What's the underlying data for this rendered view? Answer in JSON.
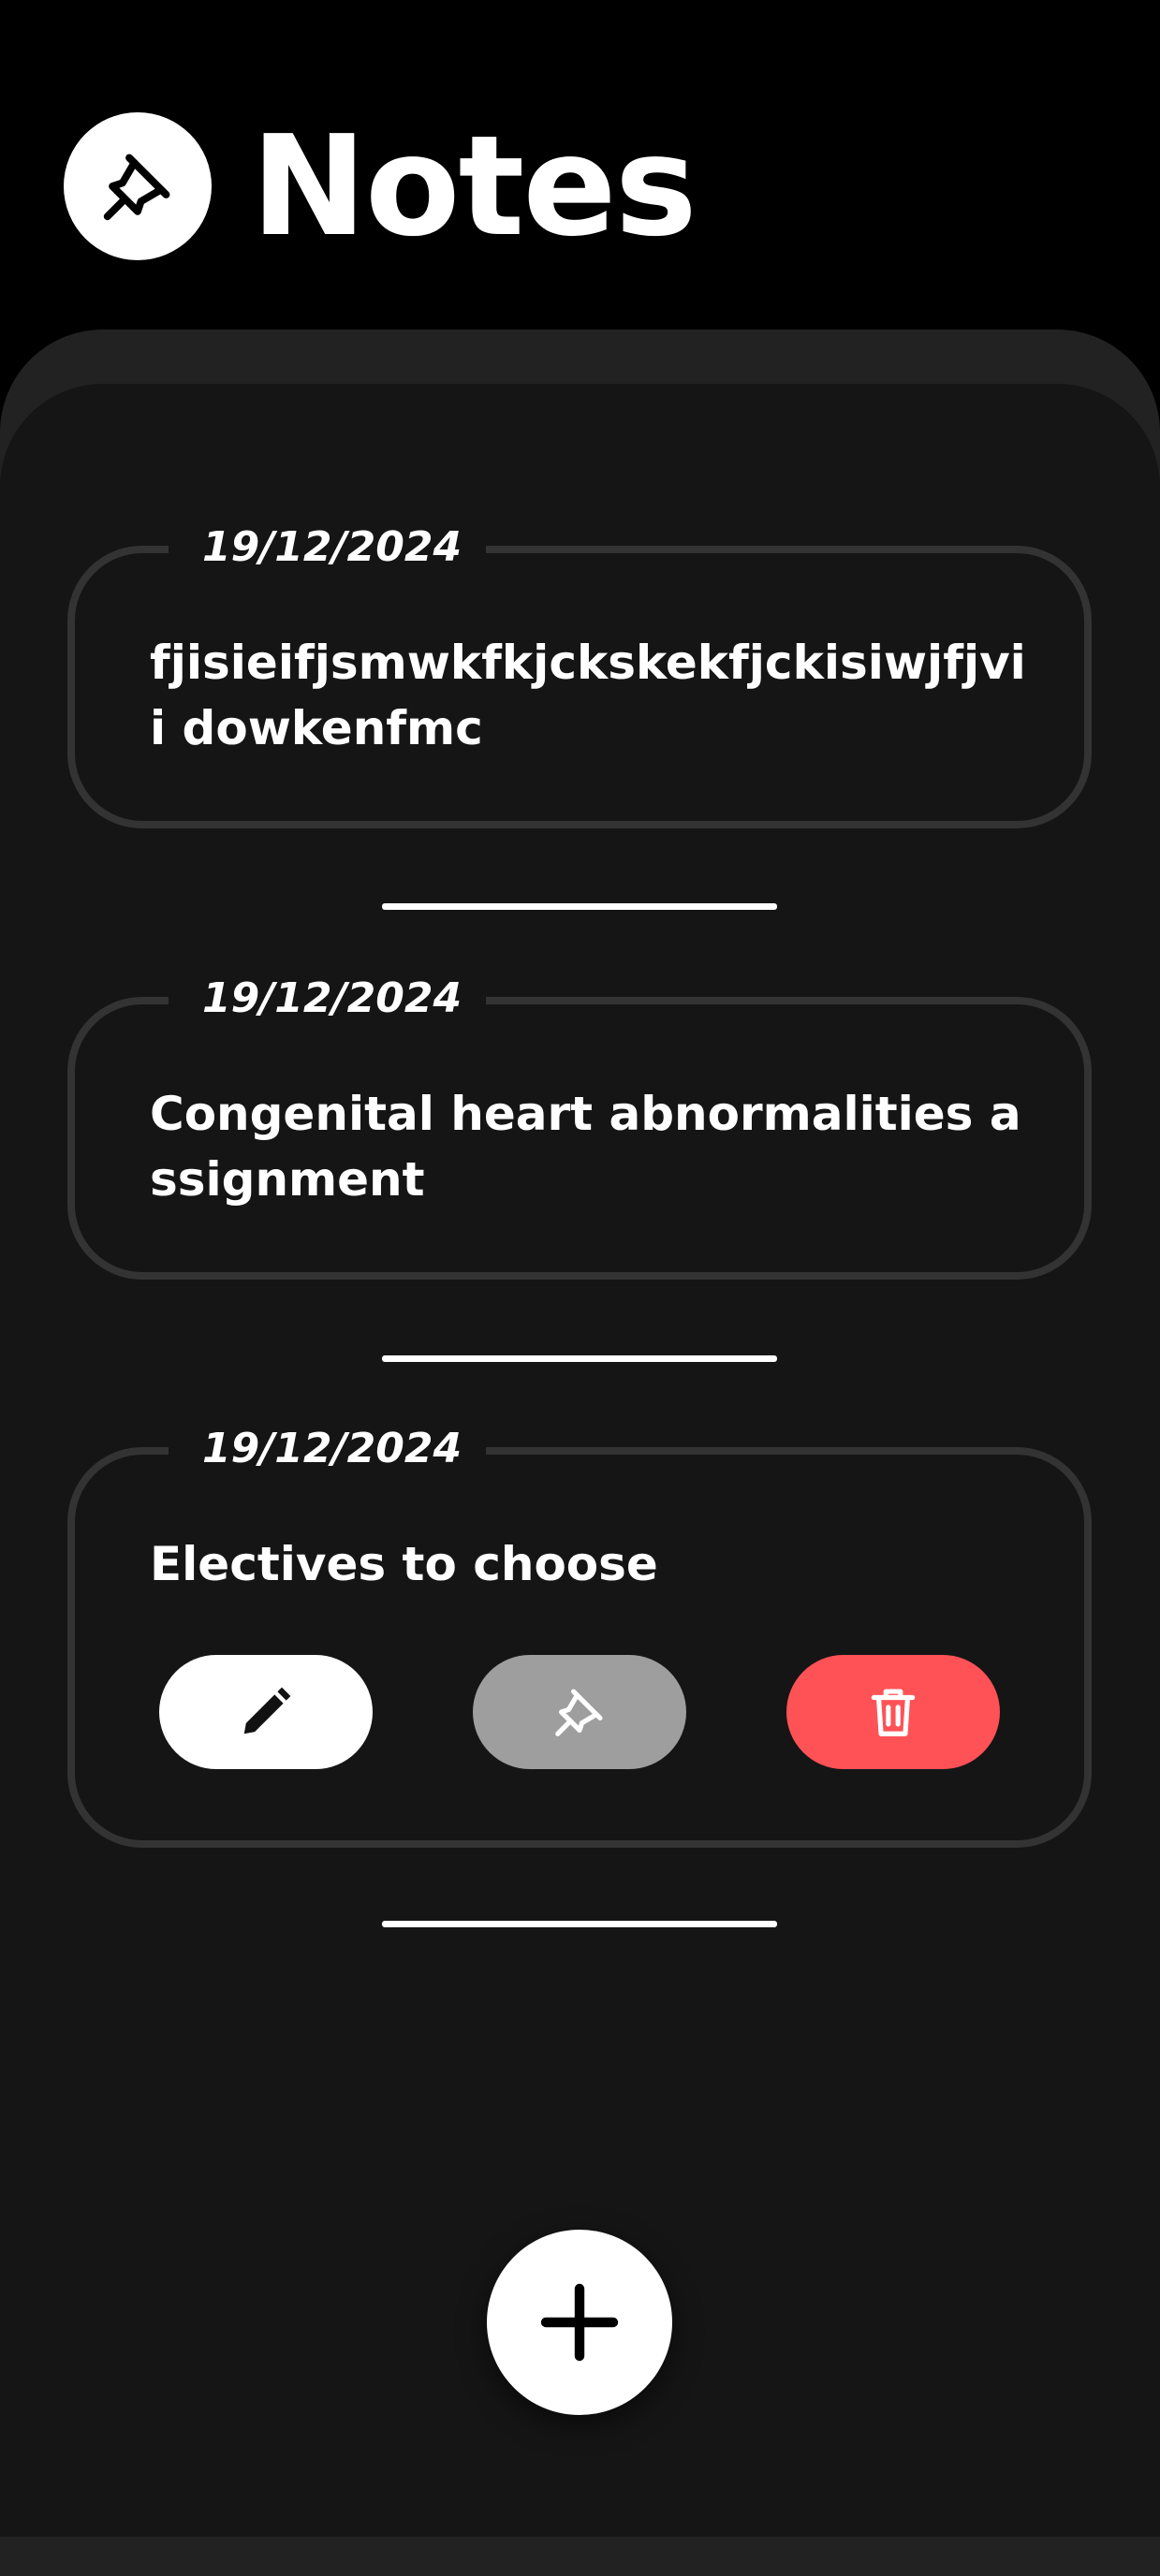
{
  "header": {
    "title": "Notes",
    "icon": "pin-icon"
  },
  "notes": [
    {
      "date": "19/12/2024",
      "text": "fjisieifjsmwkfkjckskekfjckisiwjfjvii dowkenfmc"
    },
    {
      "date": "19/12/2024",
      "text": "Congenital heart abnormalities assignment"
    },
    {
      "date": "19/12/2024",
      "text": "Electives to choose"
    }
  ],
  "actions": {
    "edit": {
      "icon": "pencil-icon",
      "color": "#ffffff"
    },
    "pin": {
      "icon": "pin-icon",
      "color": "#9e9e9e"
    },
    "delete": {
      "icon": "trash-icon",
      "color": "#ff5257"
    }
  },
  "fab": {
    "icon": "plus-icon"
  },
  "colors": {
    "background": "#000000",
    "sheet": "#151515",
    "card_border": "#333333",
    "text": "#ffffff",
    "danger": "#ff5257"
  }
}
